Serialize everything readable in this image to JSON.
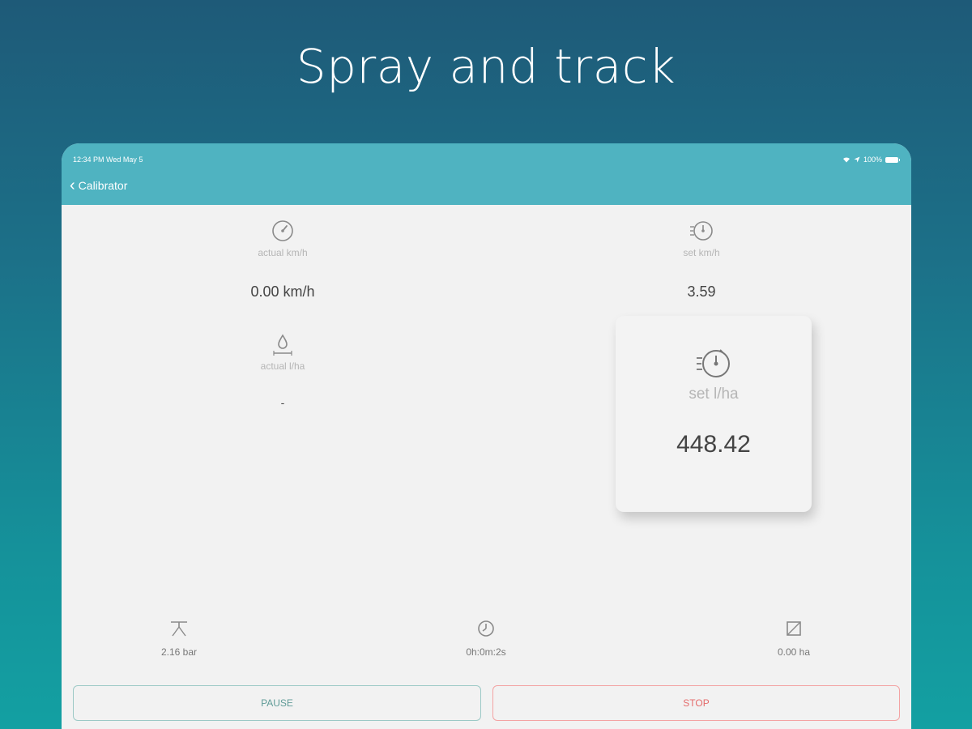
{
  "promo": {
    "title": "Spray and track"
  },
  "status_bar": {
    "time": "12:34 PM   Wed May 5",
    "battery": "100%"
  },
  "nav": {
    "back_label": "Calibrator"
  },
  "metrics": {
    "actual_speed": {
      "label": "actual km/h",
      "value": "0.00 km/h",
      "icon": "speedometer-icon"
    },
    "set_speed": {
      "label": "set km/h",
      "value": "3.59",
      "icon": "timer-icon"
    },
    "actual_rate": {
      "label": "actual l/ha",
      "value": "-",
      "icon": "droplet-icon"
    },
    "set_rate": {
      "label": "set l/ha",
      "value": "448.42",
      "icon": "timer-icon"
    }
  },
  "stats": {
    "pressure": {
      "value": "2.16 bar",
      "icon": "nozzle-icon"
    },
    "elapsed": {
      "value": "0h:0m:2s",
      "icon": "clock-icon"
    },
    "area": {
      "value": "0.00 ha",
      "icon": "area-icon"
    }
  },
  "buttons": {
    "pause": "PAUSE",
    "stop": "STOP"
  },
  "colors": {
    "navbar": "#4fb3c1",
    "pause": "#5f9b97",
    "stop": "#e46b6b"
  }
}
